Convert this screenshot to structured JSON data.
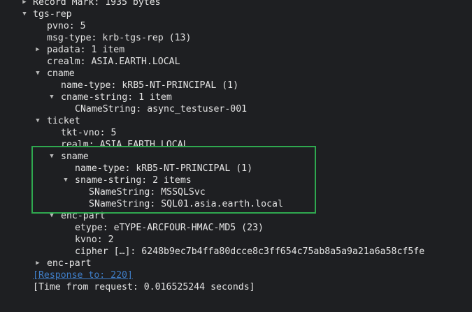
{
  "tree": {
    "record_mark": "Record Mark: 1935 bytes",
    "tgs_rep": "tgs-rep",
    "pvno": "pvno: 5",
    "msg_type": "msg-type: krb-tgs-rep (13)",
    "padata": "padata: 1 item",
    "crealm": "crealm: ASIA.EARTH.LOCAL",
    "cname": "cname",
    "cname_name_type": "name-type: kRB5-NT-PRINCIPAL (1)",
    "cname_string": "cname-string: 1 item",
    "cname_string_value": "CNameString: async_testuser-001",
    "ticket": "ticket",
    "tkt_vno": "tkt-vno: 5",
    "realm": "realm: ASIA.EARTH.LOCAL",
    "sname": "sname",
    "sname_name_type": "name-type: kRB5-NT-PRINCIPAL (1)",
    "sname_string": "sname-string: 2 items",
    "sname_string_1": "SNameString: MSSQLSvc",
    "sname_string_2": "SNameString: SQL01.asia.earth.local",
    "ticket_enc_part": "enc-part",
    "etype": "etype: eTYPE-ARCFOUR-HMAC-MD5 (23)",
    "kvno": "kvno: 2",
    "cipher": "cipher […]: 6248b9ec7b4ffa80dcce8c3ff654c75ab8a5a9a21a6a58cf5fe",
    "enc_part": "enc-part",
    "response_to": "[Response to: 220]",
    "time_from_request": "[Time from request: 0.016525244 seconds]"
  },
  "icons": {
    "expanded": "triangle-down",
    "collapsed": "triangle-right"
  },
  "colors": {
    "background": "#1e1f22",
    "text": "#e4e4e4",
    "link": "#3f7ec8",
    "highlight_border": "#2fa84f"
  }
}
